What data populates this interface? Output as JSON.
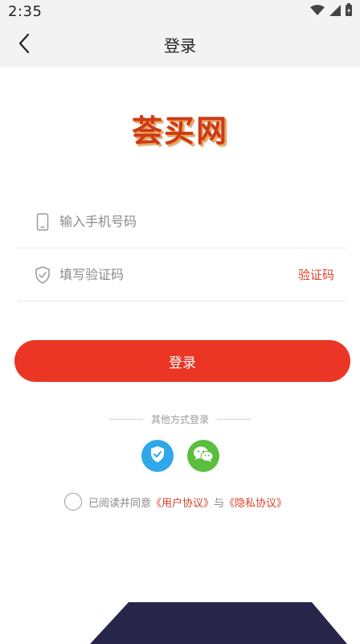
{
  "status_bar": {
    "time": "2:35"
  },
  "header": {
    "title": "登录"
  },
  "logo": {
    "text": "荟买网"
  },
  "form": {
    "phone_placeholder": "输入手机号码",
    "code_placeholder": "填写验证码",
    "get_code_label": "验证码"
  },
  "login_button": {
    "label": "登录"
  },
  "other_login": {
    "label": "其他方式登录"
  },
  "agreement": {
    "prefix": "已阅读并同意",
    "user_agreement": "《用户协议》",
    "connector": "与",
    "privacy_policy": "《隐私协议》"
  },
  "colors": {
    "primary_red": "#eb3525",
    "link_red": "#d9432a",
    "shield_blue": "#2fa8ea",
    "wechat_green": "#5bbf3d",
    "bottom_navy": "#27264a"
  },
  "icons": {
    "back": "chevron-left-icon",
    "phone": "phone-icon",
    "code": "shield-check-icon",
    "social_1": "shield-check-icon",
    "social_2": "wechat-icon"
  }
}
